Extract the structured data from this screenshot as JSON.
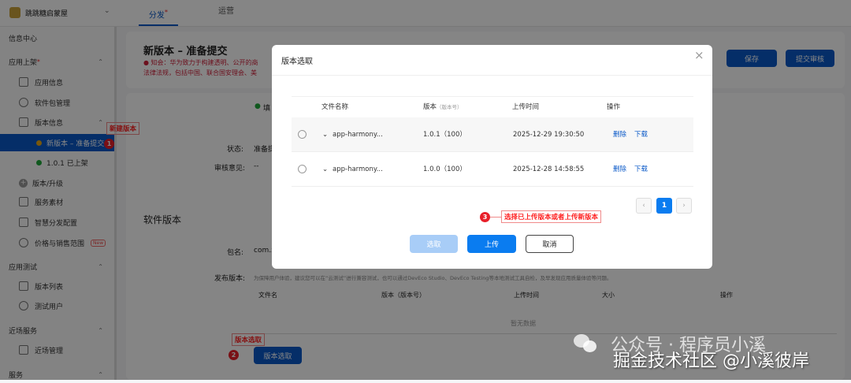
{
  "topbar": {
    "app_name": "跳跳糖启蒙屋",
    "tabs": [
      {
        "label": "分发",
        "active": true,
        "dot": true
      },
      {
        "label": "运营"
      }
    ]
  },
  "sidebar": {
    "info_center": "信息中心",
    "app_listing": "应用上架",
    "items": [
      "应用信息",
      "软件包管理",
      "版本信息"
    ],
    "versions": [
      {
        "label": "新版本 – 准备提交",
        "status": "pending"
      },
      {
        "label": "1.0.1 已上架",
        "status": "live"
      }
    ],
    "version_upgrade": "版本/升级",
    "more_items": [
      "服务素材",
      "智慧分发配置",
      "价格与销售范围"
    ],
    "new_badge": "New",
    "app_test": "应用测试",
    "test_items": [
      "版本列表",
      "测试用户"
    ],
    "nearby": "近场服务",
    "nearby_items": [
      "近场管理"
    ],
    "service": "服务"
  },
  "main": {
    "title": "新版本 – 准备提交",
    "notice_line1": "知会：华为致力于构建透明、公开的商",
    "notice_line2": "法律法规，包括中国、联合国安理会、美",
    "save": "保存",
    "submit": "提交审核",
    "step_fill": "填",
    "status_label": "状态:",
    "status_value": "准备提",
    "review_label": "审核意见:",
    "review_value": "--",
    "software_version": "软件版本",
    "package_label": "包名:",
    "package_value": "com.x",
    "release_label": "发布版本:",
    "release_hint": "为保障用户体验，建议您可以在“云测试”进行兼容测试，也可以通过DevEco Studio、DevEco Testing等本地测试工具自检，及早发现应用质量体验等问题。",
    "table_headers": [
      "文件名",
      "版本（版本号）",
      "上传时间",
      "大小",
      "操作"
    ],
    "empty": "暂无数据",
    "select_version_btn": "版本选取"
  },
  "annotations": {
    "a1": "新建版本",
    "a2": "版本选取",
    "a3": "选择已上传版本或者上传新版本",
    "n1": "1",
    "n2": "2",
    "n3": "3"
  },
  "modal": {
    "title": "版本选取",
    "headers": {
      "name": "文件名称",
      "version": "版本",
      "version_sub": "（版本号）",
      "time": "上传时间",
      "ops": "操作"
    },
    "rows": [
      {
        "name": "app-harmony...",
        "version": "1.0.1（100）",
        "time": "2025-12-29 19:30:50",
        "delete": "删除",
        "download": "下载"
      },
      {
        "name": "app-harmony...",
        "version": "1.0.0（100）",
        "time": "2025-12-28 14:58:55",
        "delete": "删除",
        "download": "下载"
      }
    ],
    "page": "1",
    "select_btn": "选取",
    "upload_btn": "上传",
    "cancel_btn": "取消"
  },
  "watermark": {
    "line1": "公众号 · 程序员小溪",
    "line2": "掘金技术社区 @小溪彼岸"
  }
}
